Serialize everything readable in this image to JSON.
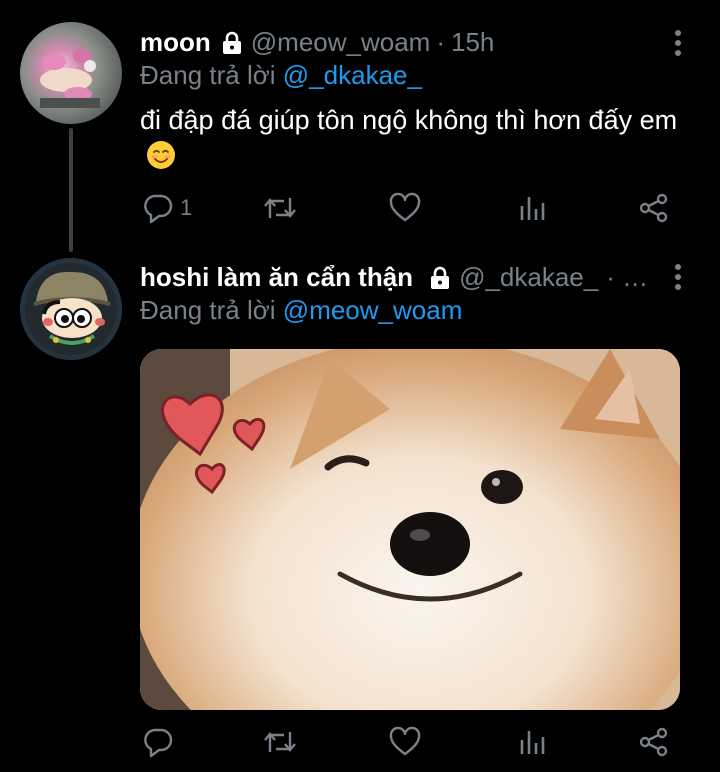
{
  "tweets": [
    {
      "name": "moon",
      "handle": "@meow_woam",
      "separator": "·",
      "time": "15h",
      "reply_prefix": "Đang trả lời",
      "reply_mention": "@_dkakae_",
      "text": "đi đập đá giúp tôn ngộ không thì hơn đấy em",
      "emoji": "smiling-face-icon",
      "reply_count": "1"
    },
    {
      "name": "hoshi làm ăn cẩn thận",
      "handle": "@_dkakae_",
      "separator": "· …",
      "reply_prefix": "Đang trả lời",
      "reply_mention": "@meow_woam"
    }
  ],
  "icons": {
    "lock": "lock-icon",
    "more": "more-vertical-icon",
    "reply": "reply-icon",
    "retweet": "retweet-icon",
    "like": "heart-icon",
    "analytics": "analytics-icon",
    "share": "share-icon"
  },
  "colors": {
    "background": "#000000",
    "text": "#ffffff",
    "muted": "#7a8189",
    "link": "#1d9bf0",
    "thread_line": "#3a3f44"
  }
}
